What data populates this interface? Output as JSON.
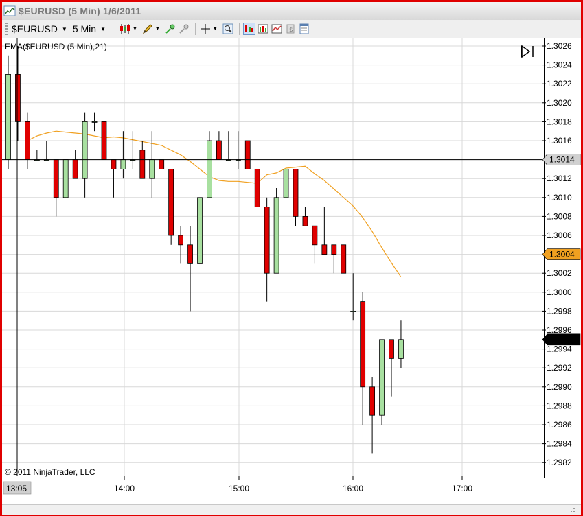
{
  "window": {
    "title": "$EURUSD (5 Min)  1/6/2011"
  },
  "toolbar": {
    "instrument": "$EURUSD",
    "interval": "5 Min",
    "icons": [
      "candlestick-style-icon",
      "drawing-pencil-icon",
      "zoom-in-icon",
      "zoom-out-icon",
      "crosshair-icon",
      "magnifier-icon",
      "chart-style-icon",
      "data-series-icon",
      "indicators-icon",
      "strategies-icon",
      "properties-icon"
    ]
  },
  "chart": {
    "indicator_label": "EMA($EURUSD (5 Min),21)",
    "copyright": "© 2011 NinjaTrader, LLC",
    "crosshair_time_label": "13:05",
    "crosshair_price_label": "1.3014",
    "ema_price_label": "1.3004",
    "last_price_label": "1.2995",
    "colors": {
      "up_candle": "#a8e0a0",
      "down_candle": "#e00000",
      "ema_line": "#f0a020",
      "ema_label_bg": "#f0a020",
      "last_label_bg": "#000000",
      "crosshair_label_bg": "#d0d0d0",
      "grid": "#d8d8d8",
      "window_border": "#e00000"
    }
  },
  "chart_data": {
    "type": "candlestick",
    "title": "$EURUSD (5 Min)  1/6/2011",
    "y_ticks": [
      "1.3026",
      "1.3024",
      "1.3022",
      "1.3020",
      "1.3018",
      "1.3016",
      "1.3014",
      "1.3012",
      "1.3010",
      "1.3008",
      "1.3006",
      "1.3004",
      "1.3002",
      "1.3000",
      "1.2998",
      "1.2996",
      "1.2994",
      "1.2992",
      "1.2990",
      "1.2988",
      "1.2986",
      "1.2984",
      "1.2982"
    ],
    "x_ticks": [
      "14:00",
      "15:00",
      "16:00",
      "17:00"
    ],
    "ylim": [
      1.29805,
      1.30265
    ],
    "candles": [
      {
        "open": 1.3014,
        "high": 1.3025,
        "low": 1.3013,
        "close": 1.3023
      },
      {
        "open": 1.3023,
        "high": 1.3026,
        "low": 1.3016,
        "close": 1.3018
      },
      {
        "open": 1.3018,
        "high": 1.3019,
        "low": 1.3013,
        "close": 1.3014
      },
      {
        "open": 1.3014,
        "high": 1.3015,
        "low": 1.3014,
        "close": 1.3014
      },
      {
        "open": 1.3014,
        "high": 1.3016,
        "low": 1.3014,
        "close": 1.3014
      },
      {
        "open": 1.3014,
        "high": 1.3014,
        "low": 1.3008,
        "close": 1.301
      },
      {
        "open": 1.301,
        "high": 1.3014,
        "low": 1.301,
        "close": 1.3014
      },
      {
        "open": 1.3014,
        "high": 1.3015,
        "low": 1.3012,
        "close": 1.3012
      },
      {
        "open": 1.3012,
        "high": 1.3019,
        "low": 1.301,
        "close": 1.3018
      },
      {
        "open": 1.3018,
        "high": 1.3019,
        "low": 1.3017,
        "close": 1.3018
      },
      {
        "open": 1.3018,
        "high": 1.3018,
        "low": 1.3014,
        "close": 1.3014
      },
      {
        "open": 1.3014,
        "high": 1.3014,
        "low": 1.301,
        "close": 1.3013
      },
      {
        "open": 1.3013,
        "high": 1.3017,
        "low": 1.3012,
        "close": 1.3014
      },
      {
        "open": 1.3014,
        "high": 1.3017,
        "low": 1.3013,
        "close": 1.3014
      },
      {
        "open": 1.3015,
        "high": 1.3016,
        "low": 1.3012,
        "close": 1.3012
      },
      {
        "open": 1.3012,
        "high": 1.3017,
        "low": 1.301,
        "close": 1.3014
      },
      {
        "open": 1.3014,
        "high": 1.3014,
        "low": 1.3013,
        "close": 1.3013
      },
      {
        "open": 1.3013,
        "high": 1.3013,
        "low": 1.3005,
        "close": 1.3006
      },
      {
        "open": 1.3006,
        "high": 1.3007,
        "low": 1.3003,
        "close": 1.3005
      },
      {
        "open": 1.3005,
        "high": 1.3007,
        "low": 1.2998,
        "close": 1.3003
      },
      {
        "open": 1.3003,
        "high": 1.3008,
        "low": 1.3003,
        "close": 1.301
      },
      {
        "open": 1.301,
        "high": 1.3017,
        "low": 1.301,
        "close": 1.3016
      },
      {
        "open": 1.3016,
        "high": 1.3017,
        "low": 1.3014,
        "close": 1.3014
      },
      {
        "open": 1.3014,
        "high": 1.3017,
        "low": 1.3014,
        "close": 1.3014
      },
      {
        "open": 1.3014,
        "high": 1.3017,
        "low": 1.3013,
        "close": 1.3014
      },
      {
        "open": 1.3016,
        "high": 1.3016,
        "low": 1.3013,
        "close": 1.3013
      },
      {
        "open": 1.3013,
        "high": 1.3013,
        "low": 1.3009,
        "close": 1.3009
      },
      {
        "open": 1.3009,
        "high": 1.301,
        "low": 1.2999,
        "close": 1.3002
      },
      {
        "open": 1.3002,
        "high": 1.3011,
        "low": 1.3002,
        "close": 1.301
      },
      {
        "open": 1.301,
        "high": 1.3012,
        "low": 1.301,
        "close": 1.3013
      },
      {
        "open": 1.3013,
        "high": 1.3013,
        "low": 1.3007,
        "close": 1.3008
      },
      {
        "open": 1.3008,
        "high": 1.3009,
        "low": 1.3007,
        "close": 1.3007
      },
      {
        "open": 1.3007,
        "high": 1.3007,
        "low": 1.3003,
        "close": 1.3005
      },
      {
        "open": 1.3005,
        "high": 1.3009,
        "low": 1.3004,
        "close": 1.3004
      },
      {
        "open": 1.3005,
        "high": 1.3005,
        "low": 1.3002,
        "close": 1.3004
      },
      {
        "open": 1.3005,
        "high": 1.3005,
        "low": 1.3002,
        "close": 1.3002
      },
      {
        "open": 1.2998,
        "high": 1.3002,
        "low": 1.2997,
        "close": 1.2998
      },
      {
        "open": 1.2999,
        "high": 1.3,
        "low": 1.2986,
        "close": 1.299
      },
      {
        "open": 1.299,
        "high": 1.2991,
        "low": 1.2983,
        "close": 1.2987
      },
      {
        "open": 1.2987,
        "high": 1.2994,
        "low": 1.2986,
        "close": 1.2995
      },
      {
        "open": 1.2995,
        "high": 1.2995,
        "low": 1.2989,
        "close": 1.2993
      },
      {
        "open": 1.2993,
        "high": 1.2997,
        "low": 1.2992,
        "close": 1.2995
      }
    ],
    "ema": [
      1.3016,
      1.30165,
      1.30168,
      1.3017,
      1.30169,
      1.30168,
      1.30167,
      1.30165,
      1.30163,
      1.30164,
      1.30163,
      1.30161,
      1.30159,
      1.30157,
      1.30155,
      1.3015,
      1.30145,
      1.30138,
      1.3013,
      1.30122,
      1.30118,
      1.30117,
      1.30117,
      1.30116,
      1.30115,
      1.30124,
      1.30126,
      1.30131,
      1.30132,
      1.30133,
      1.30125,
      1.30118,
      1.30109,
      1.301,
      1.30091,
      1.30079,
      1.30064,
      1.30047,
      1.30031,
      1.30016
    ]
  }
}
